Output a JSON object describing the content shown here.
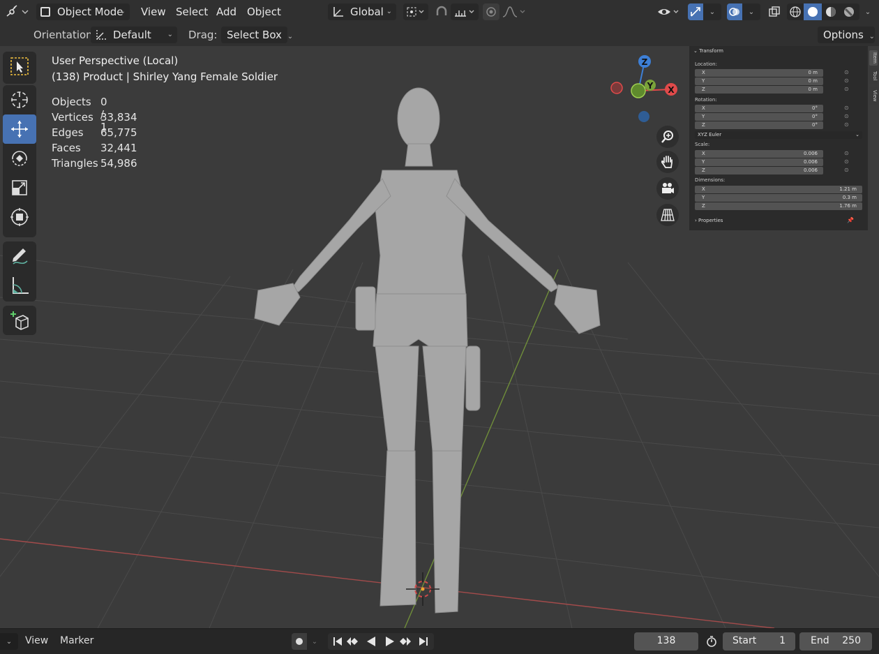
{
  "header": {
    "mode_label": "Object Mode",
    "menus": [
      "View",
      "Select",
      "Add",
      "Object"
    ],
    "transform_orientation": "Global",
    "options_label": "Options"
  },
  "tool_header": {
    "orientation_label": "Orientation:",
    "orientation_value": "Default",
    "drag_label": "Drag:",
    "drag_value": "Select Box"
  },
  "overlay": {
    "view_name": "User Perspective (Local)",
    "object_name": "(138) Product | Shirley Yang Female Soldier",
    "stats": [
      {
        "label": "Objects",
        "value": "0 / 1"
      },
      {
        "label": "Vertices",
        "value": "33,834"
      },
      {
        "label": "Edges",
        "value": "65,775"
      },
      {
        "label": "Faces",
        "value": "32,441"
      },
      {
        "label": "Triangles",
        "value": "54,986"
      }
    ]
  },
  "gizmo": {
    "x": "X",
    "y": "Y",
    "z": "Z"
  },
  "npanel": {
    "transform_title": "Transform",
    "location_label": "Location:",
    "location": [
      {
        "axis": "X",
        "value": "0 m"
      },
      {
        "axis": "Y",
        "value": "0 m"
      },
      {
        "axis": "Z",
        "value": "0 m"
      }
    ],
    "rotation_label": "Rotation:",
    "rotation": [
      {
        "axis": "X",
        "value": "0°"
      },
      {
        "axis": "Y",
        "value": "0°"
      },
      {
        "axis": "Z",
        "value": "0°"
      }
    ],
    "rotation_mode": "XYZ Euler",
    "scale_label": "Scale:",
    "scale": [
      {
        "axis": "X",
        "value": "0.006"
      },
      {
        "axis": "Y",
        "value": "0.006"
      },
      {
        "axis": "Z",
        "value": "0.006"
      }
    ],
    "dimensions_label": "Dimensions:",
    "dimensions": [
      {
        "axis": "X",
        "value": "1.21 m"
      },
      {
        "axis": "Y",
        "value": "0.3 m"
      },
      {
        "axis": "Z",
        "value": "1.76 m"
      }
    ],
    "properties_label": "Properties",
    "tabs": [
      "Item",
      "Tool",
      "View"
    ]
  },
  "timeline": {
    "menus": [
      "View",
      "Marker"
    ],
    "current_frame": "138",
    "start_label": "Start",
    "start_value": "1",
    "end_label": "End",
    "end_value": "250"
  },
  "colors": {
    "accent": "#4772b3",
    "x_axis": "#e04a4a",
    "y_axis": "#7aa33a",
    "z_axis": "#3d7fd6"
  }
}
